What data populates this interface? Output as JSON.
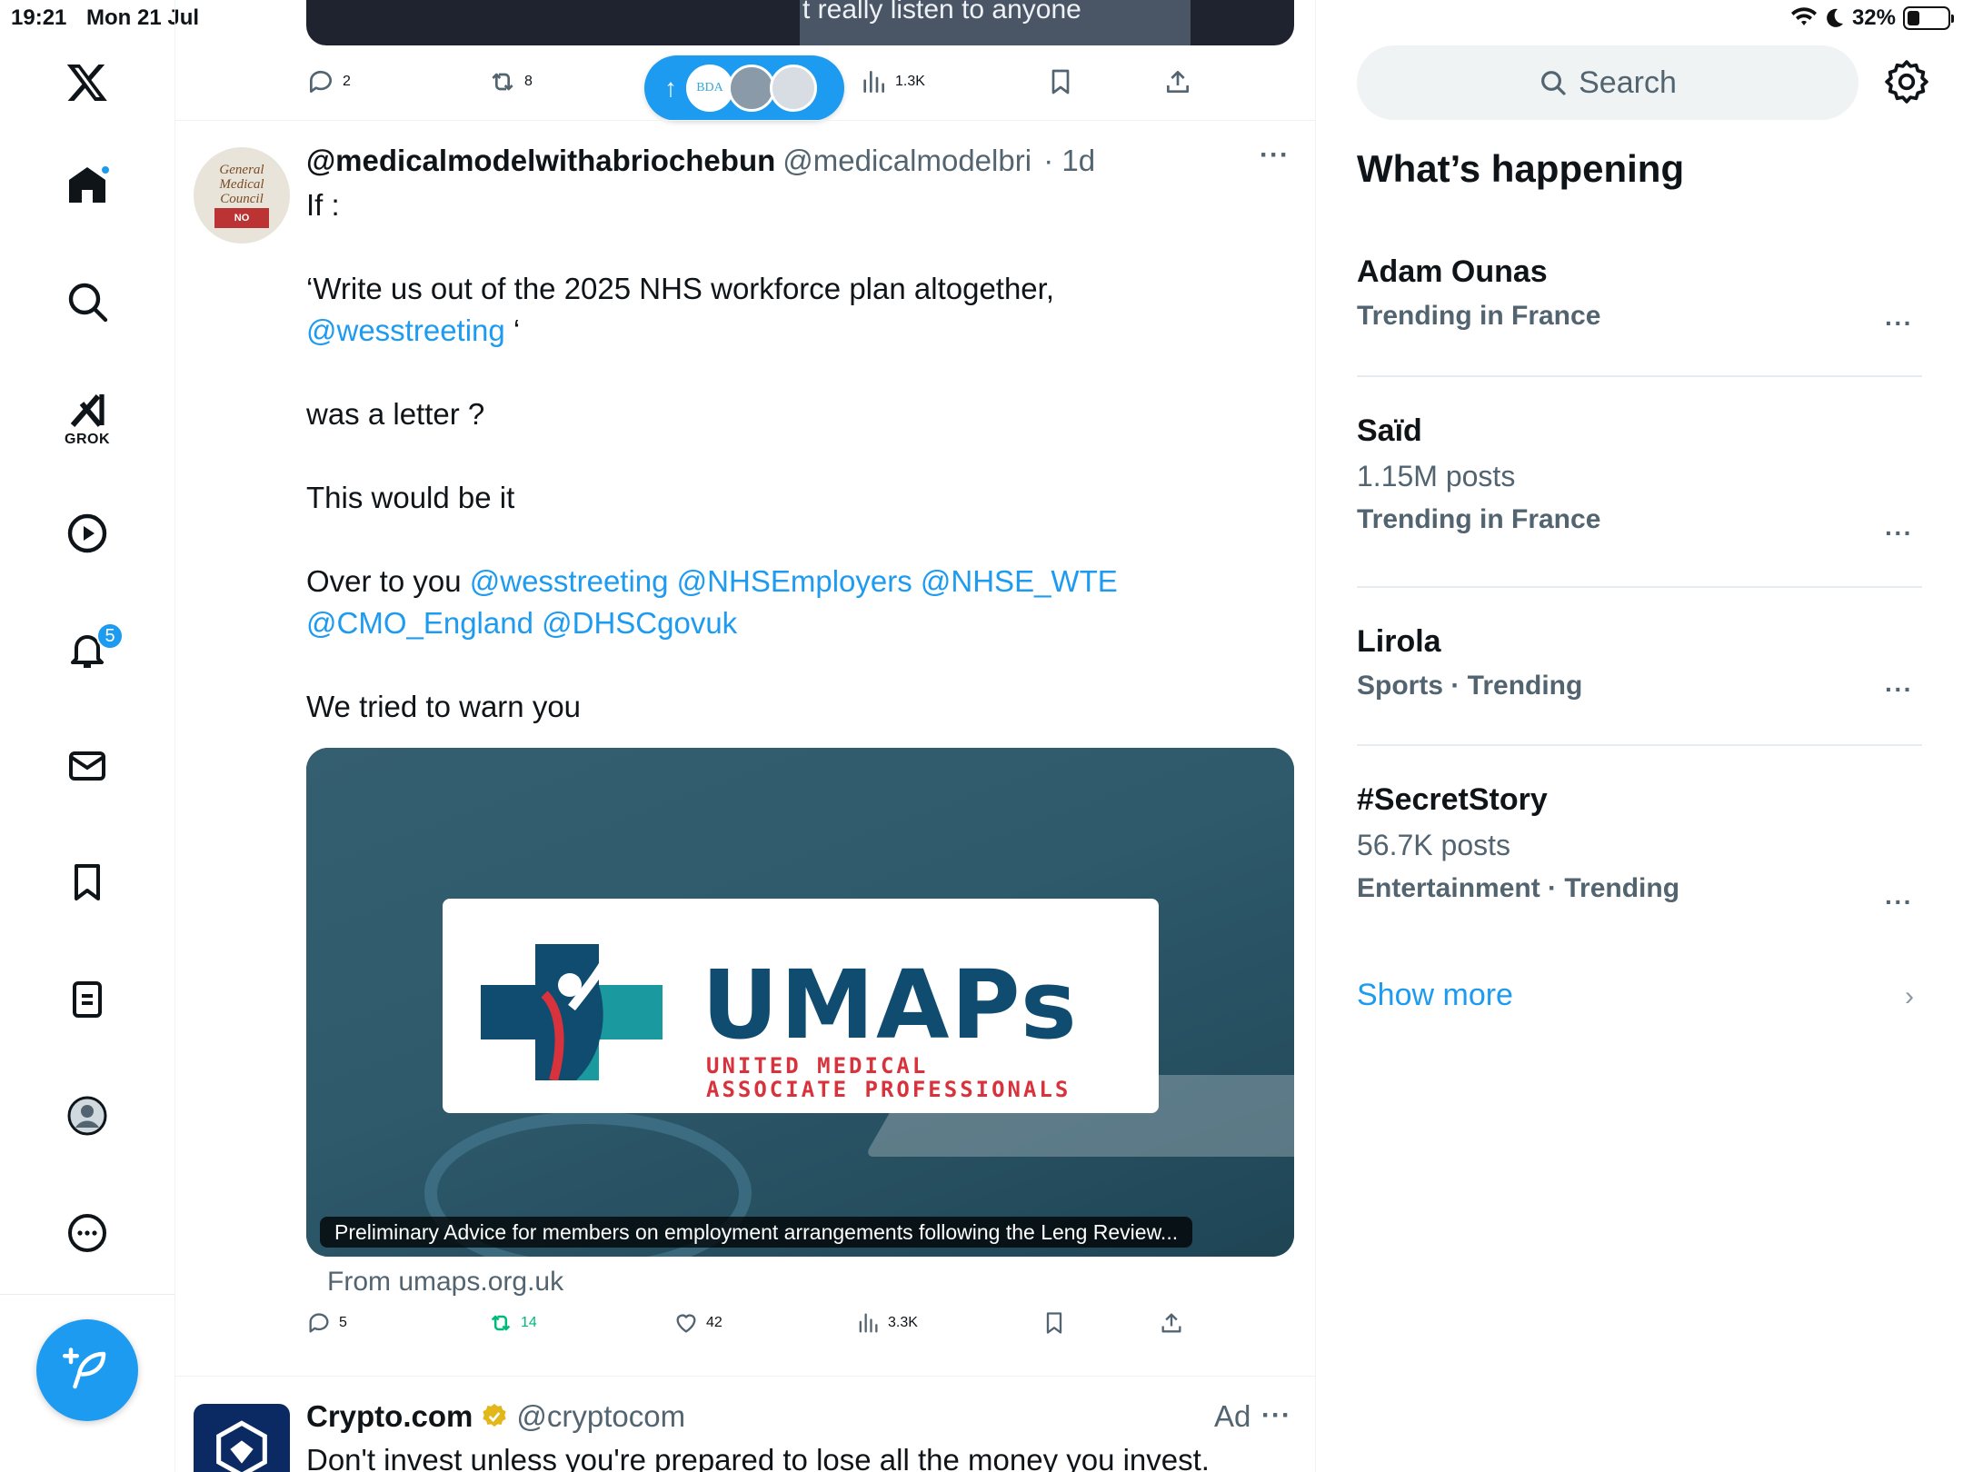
{
  "status_bar": {
    "time": "19:21",
    "date": "Mon 21 Jul",
    "battery_percent": "32%",
    "battery_level": 0.32
  },
  "nav": {
    "items": [
      "Home",
      "Explore",
      "Grok",
      "Video",
      "Notifications",
      "Messages",
      "Bookmarks",
      "Lists",
      "Profile",
      "More"
    ],
    "grok_label": "GROK",
    "notifications_badge": "5"
  },
  "previous_post": {
    "media_caption": "t really listen to anyone",
    "replies": "2",
    "reposts": "8",
    "views": "1.3K"
  },
  "new_posts_pill": {
    "avatar_text": "BDA"
  },
  "post": {
    "display_name": "@medicalmodelwithabriochebun",
    "handle": "@medicalmodelbri",
    "time": "· 1d",
    "avatar_text": [
      "General",
      "Medical",
      "Council"
    ],
    "avatar_stamp": "NO",
    "text": {
      "line1": "If :",
      "line2_a": "‘Write us out of the 2025 NHS workforce plan altogether,",
      "line2_mention": "@wesstreeting",
      "line2_b": " ‘",
      "line3": "was a letter ?",
      "line4": "This would be it",
      "line5_a": "Over to you ",
      "line5_mentions_1": "@wesstreeting @NHSEmployers @NHSE_WTE",
      "line5_mentions_2": "@CMO_England @DHSCgovuk",
      "line6": "We tried to warn you"
    },
    "card": {
      "logo_title": "UMAPs",
      "logo_sub1": "UNITED MEDICAL",
      "logo_sub2": "ASSOCIATE PROFESSIONALS",
      "caption": "Preliminary Advice for members on employment arrangements following the Leng Review...",
      "from": "From umaps.org.uk"
    },
    "stats": {
      "replies": "5",
      "reposts": "14",
      "likes": "42",
      "views": "3.3K"
    }
  },
  "ad_post": {
    "display_name": "Crypto.com",
    "handle": "@cryptocom",
    "label": "Ad",
    "text": "Don't invest unless you're prepared to lose all the money you invest."
  },
  "sidebar": {
    "search_placeholder": "Search",
    "section_title": "What’s happening",
    "trends": [
      {
        "name": "Adam Ounas",
        "posts": "",
        "meta": "Trending in France"
      },
      {
        "name": "Saïd",
        "posts": "1.15M posts",
        "meta": "Trending in France"
      },
      {
        "name": "Lirola",
        "posts": "",
        "meta": "Sports · Trending"
      },
      {
        "name": "#SecretStory",
        "posts": "56.7K posts",
        "meta": "Entertainment · Trending"
      }
    ],
    "show_more": "Show more"
  },
  "colors": {
    "accent": "#1d9bf0",
    "text": "#0f1419",
    "muted": "#536471",
    "repost_active": "#00ba7c"
  }
}
